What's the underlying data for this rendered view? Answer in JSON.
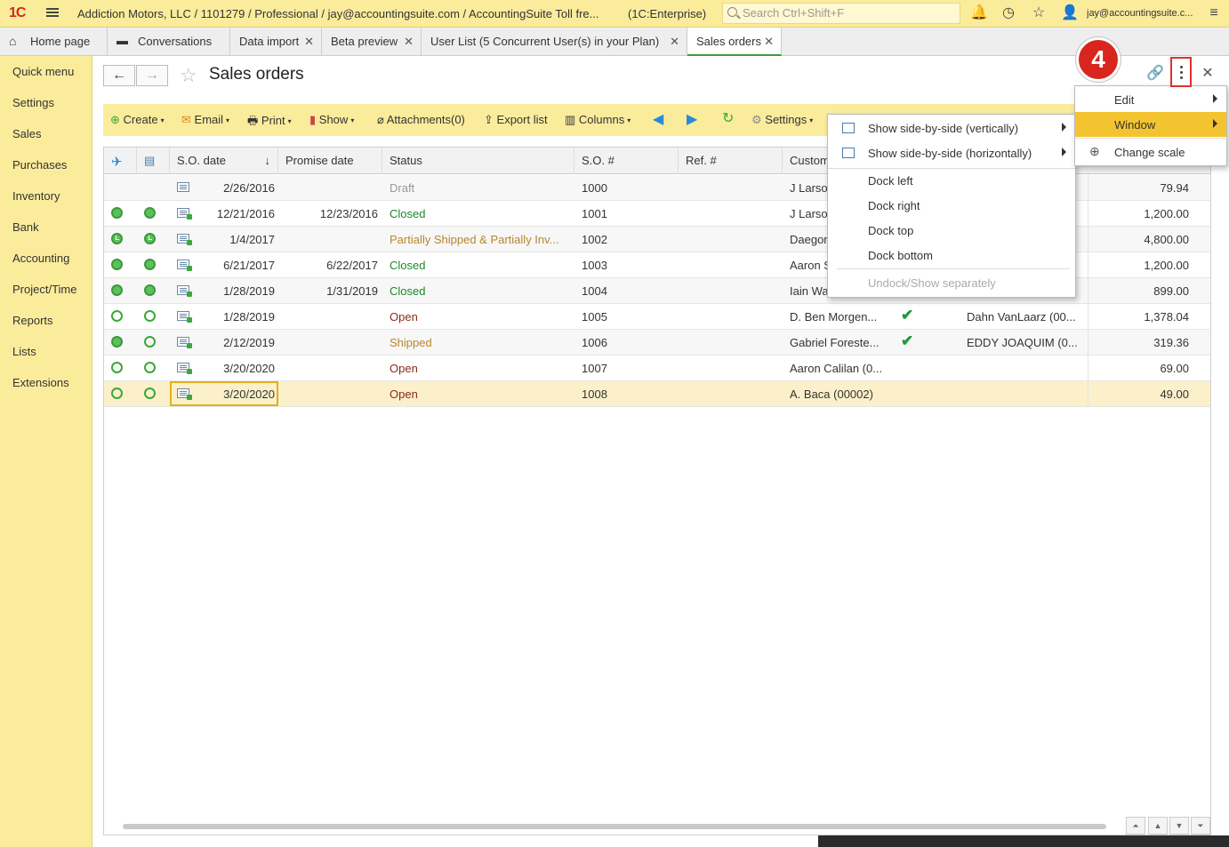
{
  "topbar": {
    "logo": "1С",
    "app_title": "Addiction Motors, LLC / 1101279 / Professional / jay@accountingsuite.com / AccountingSuite Toll fre...",
    "platform": "(1C:Enterprise)",
    "search_placeholder": "Search Ctrl+Shift+F",
    "user_email": "jay@accountingsuite.c..."
  },
  "tabs": [
    {
      "label": "Home page"
    },
    {
      "label": "Conversations"
    },
    {
      "label": "Data import"
    },
    {
      "label": "Beta preview"
    },
    {
      "label": "User List (5 Concurrent User(s) in your Plan)"
    },
    {
      "label": "Sales orders"
    }
  ],
  "sidebar": {
    "items": [
      "Quick menu",
      "Settings",
      "Sales",
      "Purchases",
      "Inventory",
      "Bank",
      "Accounting",
      "Project/Time",
      "Reports",
      "Lists",
      "Extensions"
    ]
  },
  "page": {
    "title": "Sales orders"
  },
  "toolbar": {
    "create": "Create",
    "email": "Email",
    "print": "Print",
    "show": "Show",
    "attachments": "Attachments(0)",
    "export": "Export list",
    "columns": "Columns",
    "settings": "Settings"
  },
  "table": {
    "headers": [
      "S.O. date",
      "Promise date",
      "Status",
      "S.O. #",
      "Ref. #",
      "Custom"
    ],
    "sort_indicator": "↓",
    "rows": [
      {
        "date": "2/26/2016",
        "promise": "",
        "status": "Draft",
        "status_color": "#999999",
        "num": "1000",
        "customer": "J Larso",
        "ship": "",
        "rep": "",
        "amount": "79.94",
        "icon1": "",
        "icon2": ""
      },
      {
        "date": "12/21/2016",
        "promise": "12/23/2016",
        "status": "Closed",
        "status_color": "#1a8a2a",
        "num": "1001",
        "customer": "J Larso",
        "ship": "",
        "rep": "",
        "amount": "1,200.00",
        "icon1": "full",
        "icon2": "full"
      },
      {
        "date": "1/4/2017",
        "promise": "",
        "status": "Partially Shipped & Partially Inv...",
        "status_color": "#b8862e",
        "num": "1002",
        "customer": "Daegor",
        "ship": "",
        "rep": "",
        "amount": "4,800.00",
        "icon1": "clock",
        "icon2": "clock"
      },
      {
        "date": "6/21/2017",
        "promise": "6/22/2017",
        "status": "Closed",
        "status_color": "#1a8a2a",
        "num": "1003",
        "customer": "Aaron S",
        "ship": "",
        "rep": "",
        "amount": "1,200.00",
        "icon1": "full",
        "icon2": "full"
      },
      {
        "date": "1/28/2019",
        "promise": "1/31/2019",
        "status": "Closed",
        "status_color": "#1a8a2a",
        "num": "1004",
        "customer": "Iain Wa",
        "ship": "",
        "rep": "",
        "amount": "899.00",
        "icon1": "full",
        "icon2": "full"
      },
      {
        "date": "1/28/2019",
        "promise": "",
        "status": "Open",
        "status_color": "#8b2a1a",
        "num": "1005",
        "customer": "D. Ben Morgen...",
        "ship": "✔",
        "rep": "Dahn VanLaarz (00...",
        "amount": "1,378.04",
        "icon1": "empty",
        "icon2": "empty"
      },
      {
        "date": "2/12/2019",
        "promise": "",
        "status": "Shipped",
        "status_color": "#b8862e",
        "num": "1006",
        "customer": "Gabriel Foreste...",
        "ship": "✔",
        "rep": "EDDY JOAQUIM (0...",
        "amount": "319.36",
        "icon1": "full",
        "icon2": "empty"
      },
      {
        "date": "3/20/2020",
        "promise": "",
        "status": "Open",
        "status_color": "#8b2a1a",
        "num": "1007",
        "customer": "Aaron Calilan (0...",
        "ship": "",
        "rep": "",
        "amount": "69.00",
        "icon1": "empty",
        "icon2": "empty"
      },
      {
        "date": "3/20/2020",
        "promise": "",
        "status": "Open",
        "status_color": "#8b2a1a",
        "num": "1008",
        "customer": "A. Baca (00002)",
        "ship": "",
        "rep": "",
        "amount": "49.00",
        "icon1": "empty",
        "icon2": "empty"
      }
    ]
  },
  "window_menu": {
    "items": [
      {
        "label": "Show side-by-side (vertically)"
      },
      {
        "label": "Show side-by-side (horizontally)"
      },
      {
        "label": "Dock left"
      },
      {
        "label": "Dock right"
      },
      {
        "label": "Dock top"
      },
      {
        "label": "Dock bottom"
      },
      {
        "label": "Undock/Show separately"
      }
    ]
  },
  "more_menu": {
    "items": [
      {
        "label": "Edit"
      },
      {
        "label": "Window"
      },
      {
        "label": "Change scale"
      }
    ]
  },
  "annotation": {
    "step": "4"
  },
  "colors": {
    "accent": "#fbec9c",
    "highlight": "#f4c430",
    "badge": "#d8261e"
  }
}
